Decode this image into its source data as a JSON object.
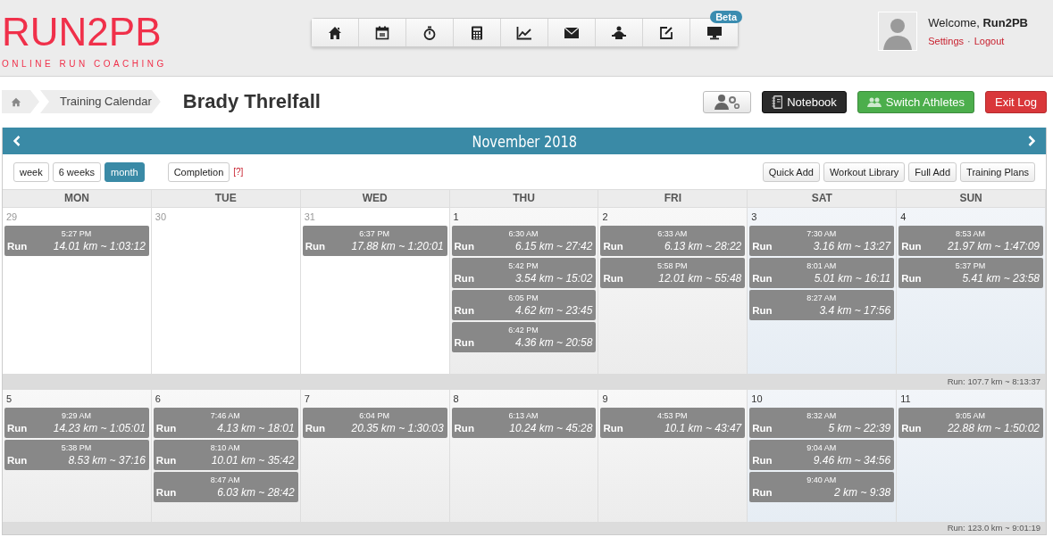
{
  "logo": {
    "title": "RUN2PB",
    "tagline": "ONLINE RUN COACHING"
  },
  "nav": {
    "badge": "Beta",
    "items": [
      {
        "kind": "home"
      },
      {
        "kind": "calendar"
      },
      {
        "kind": "stopwatch"
      },
      {
        "kind": "calculator"
      },
      {
        "kind": "chart"
      },
      {
        "kind": "mail"
      },
      {
        "kind": "lamp"
      },
      {
        "kind": "edit"
      },
      {
        "kind": "monitor"
      }
    ]
  },
  "user": {
    "greeting": "Welcome, **Run2PB**",
    "links": [
      "Settings",
      "Logout"
    ],
    "separator": "·"
  },
  "breadcrumb": {
    "items": [
      "Training Calendar"
    ]
  },
  "athlete": "Brady Threlfall",
  "actions": [
    {
      "kind": "settings"
    },
    {
      "kind": "notebook",
      "label": "Notebook"
    },
    {
      "kind": "switch",
      "label": "Switch Athletes"
    },
    {
      "kind": "exit",
      "label": "Exit Log"
    }
  ],
  "calendar": {
    "title": "November 2018",
    "views": [
      {
        "label": "week",
        "selected": false
      },
      {
        "label": "6 weeks",
        "selected": false
      },
      {
        "label": "month",
        "selected": true
      }
    ],
    "completion": "Completion",
    "help": "[?]",
    "tools": [
      "Quick Add",
      "Workout Library",
      "Full Add",
      "Training Plans"
    ],
    "days": [
      "MON",
      "TUE",
      "WED",
      "THU",
      "FRI",
      "SAT",
      "SUN"
    ],
    "weeks": [
      {
        "cells": [
          {
            "date": "29",
            "other_month": true,
            "workouts": [
              {
                "time": "5:27 PM",
                "type": "Run",
                "summary": "14.01 km ~ 1:03:12"
              }
            ]
          },
          {
            "date": "30",
            "other_month": true
          },
          {
            "date": "31",
            "other_month": true,
            "workouts": [
              {
                "time": "6:37 PM",
                "type": "Run",
                "summary": "17.88 km ~ 1:20:01"
              }
            ]
          },
          {
            "date": "1",
            "other_month": false,
            "workouts": [
              {
                "time": "6:30 AM",
                "type": "Run",
                "summary": "6.15 km ~ 27:42"
              },
              {
                "time": "5:42 PM",
                "type": "Run",
                "summary": "3.54 km ~ 15:02"
              },
              {
                "time": "6:05 PM",
                "type": "Run",
                "summary": "4.62 km ~ 23:45"
              },
              {
                "time": "6:42 PM",
                "type": "Run",
                "summary": "4.36 km ~ 20:58"
              }
            ]
          },
          {
            "date": "2",
            "other_month": false,
            "workouts": [
              {
                "time": "6:33 AM",
                "type": "Run",
                "summary": "6.13 km ~ 28:22"
              },
              {
                "time": "5:58 PM",
                "type": "Run",
                "summary": "12.01 km ~ 55:48"
              }
            ]
          },
          {
            "date": "3",
            "other_month": false,
            "workouts": [
              {
                "time": "7:30 AM",
                "type": "Run",
                "summary": "3.16 km ~ 13:27"
              },
              {
                "time": "8:01 AM",
                "type": "Run",
                "summary": "5.01 km ~ 16:11"
              },
              {
                "time": "8:27 AM",
                "type": "Run",
                "summary": "3.4 km ~ 17:56"
              }
            ]
          },
          {
            "date": "4",
            "other_month": false,
            "workouts": [
              {
                "time": "8:53 AM",
                "type": "Run",
                "summary": "21.97 km ~ 1:47:09"
              },
              {
                "time": "5:37 PM",
                "type": "Run",
                "summary": "5.41 km ~ 23:58"
              }
            ]
          }
        ],
        "summary": "Run: 107.7 km ~ 8:13:37"
      },
      {
        "cells": [
          {
            "date": "5",
            "other_month": false,
            "workouts": [
              {
                "time": "9:29 AM",
                "type": "Run",
                "summary": "14.23 km ~ 1:05:01"
              },
              {
                "time": "5:38 PM",
                "type": "Run",
                "summary": "8.53 km ~ 37:16"
              }
            ]
          },
          {
            "date": "6",
            "other_month": false,
            "workouts": [
              {
                "time": "7:46 AM",
                "type": "Run",
                "summary": "4.13 km ~ 18:01"
              },
              {
                "time": "8:10 AM",
                "type": "Run",
                "summary": "10.01 km ~ 35:42"
              },
              {
                "time": "8:47 AM",
                "type": "Run",
                "summary": "6.03 km ~ 28:42"
              }
            ]
          },
          {
            "date": "7",
            "other_month": false,
            "workouts": [
              {
                "time": "6:04 PM",
                "type": "Run",
                "summary": "20.35 km ~ 1:30:03"
              }
            ]
          },
          {
            "date": "8",
            "other_month": false,
            "workouts": [
              {
                "time": "6:13 AM",
                "type": "Run",
                "summary": "10.24 km ~ 45:28"
              }
            ]
          },
          {
            "date": "9",
            "other_month": false,
            "workouts": [
              {
                "time": "4:53 PM",
                "type": "Run",
                "summary": "10.1 km ~ 43:47"
              }
            ]
          },
          {
            "date": "10",
            "other_month": false,
            "workouts": [
              {
                "time": "8:32 AM",
                "type": "Run",
                "summary": "5 km ~ 22:39"
              },
              {
                "time": "9:04 AM",
                "type": "Run",
                "summary": "9.46 km ~ 34:56"
              },
              {
                "time": "9:40 AM",
                "type": "Run",
                "summary": "2 km ~ 9:38"
              }
            ]
          },
          {
            "date": "11",
            "other_month": false,
            "workouts": [
              {
                "time": "9:05 AM",
                "type": "Run",
                "summary": "22.88 km ~ 1:50:02"
              }
            ]
          }
        ],
        "summary": "Run: 123.0 km ~ 9:01:19"
      }
    ]
  }
}
